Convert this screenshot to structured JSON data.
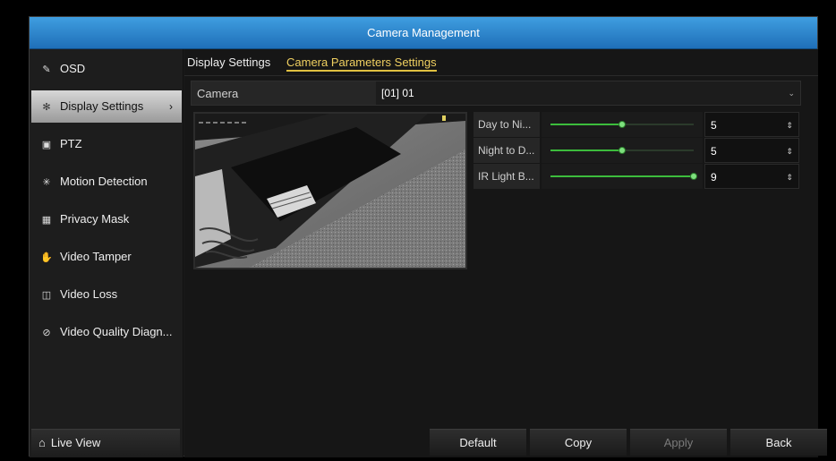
{
  "window": {
    "title": "Camera Management"
  },
  "sidebar": {
    "items": [
      {
        "label": "OSD",
        "icon": "edit-icon"
      },
      {
        "label": "Display Settings",
        "icon": "display-icon",
        "active": true
      },
      {
        "label": "PTZ",
        "icon": "ptz-icon"
      },
      {
        "label": "Motion Detection",
        "icon": "motion-icon"
      },
      {
        "label": "Privacy Mask",
        "icon": "mask-icon"
      },
      {
        "label": "Video Tamper",
        "icon": "hand-icon"
      },
      {
        "label": "Video Loss",
        "icon": "video-loss-icon"
      },
      {
        "label": "Video Quality Diagn...",
        "icon": "quality-icon"
      }
    ],
    "live_view": "Live View"
  },
  "tabs": [
    {
      "label": "Display Settings"
    },
    {
      "label": "Camera Parameters Settings",
      "active": true
    }
  ],
  "camera": {
    "label": "Camera",
    "value": "[01] 01"
  },
  "params": [
    {
      "label": "Day to Ni...",
      "value": "5",
      "level": 0.5
    },
    {
      "label": "Night to D...",
      "value": "5",
      "level": 0.5
    },
    {
      "label": "IR Light B...",
      "value": "9",
      "level": 1.0
    }
  ],
  "buttons": {
    "default": "Default",
    "copy": "Copy",
    "apply": "Apply",
    "back": "Back"
  },
  "colors": {
    "title_bar": "#2a85cf",
    "active_tab": "#f0d060",
    "slider": "#3cbc3c"
  }
}
